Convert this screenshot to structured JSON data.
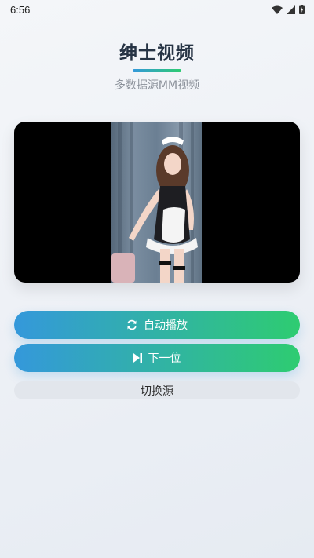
{
  "status_bar": {
    "time": "6:56",
    "icons": [
      "wifi-icon",
      "signal-icon",
      "battery-icon"
    ]
  },
  "header": {
    "title": "绅士视频",
    "subtitle": "多数据源MM视频"
  },
  "player": {
    "background": "#000000"
  },
  "buttons": {
    "autoplay_label": "自动播放",
    "autoplay_icon": "refresh-icon",
    "next_label": "下一位",
    "next_icon": "skip-next-icon",
    "switch_source_label": "切换源"
  },
  "colors": {
    "gradient_start": "#3498db",
    "gradient_end": "#2ecc71",
    "title": "#273445",
    "subtitle": "#8a9099"
  }
}
